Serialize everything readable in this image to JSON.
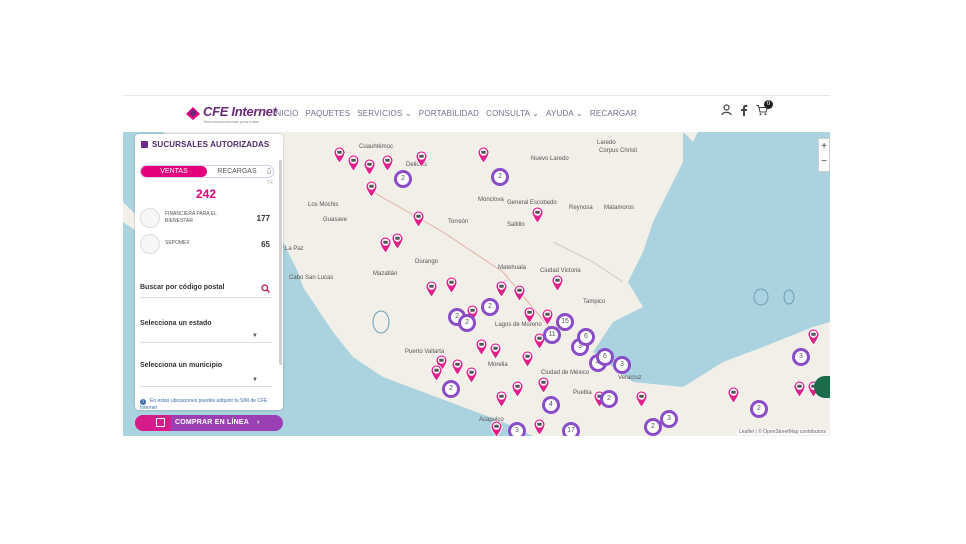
{
  "header": {
    "logo_text": "CFE Internet",
    "logo_tagline": "Telecomunicaciones para todos",
    "menu": [
      "INICIO",
      "PAQUETES",
      "SERVICIOS ⌄",
      "PORTABILIDAD",
      "CONSULTA ⌄",
      "AYUDA ⌄",
      "RECARGAR"
    ],
    "cart_count": "0",
    "icons": [
      "user-icon",
      "facebook-icon",
      "cart-icon"
    ]
  },
  "panel": {
    "title": "SUCURSALES AUTORIZADAS",
    "tab_active": "VENTAS",
    "tab_other": "RECARGAS",
    "total": "242",
    "tx_label": "TX",
    "providers": [
      {
        "name": "FINANCIERA PARA EL BIENESTAR",
        "count": "177"
      },
      {
        "name": "SEPOMEX",
        "count": "65"
      }
    ],
    "postal_label": "Buscar por código postal",
    "state_label": "Selecciona un estado",
    "municipality_label": "Selecciona un municipio",
    "note": "En estas ubicaciones puedes adquirir tu SIM de CFE Internet",
    "buy_button": "COMPRAR EN LÍNEA"
  },
  "map": {
    "labels": [
      {
        "text": "Cuauhtémoc"
      },
      {
        "text": "Delicias"
      },
      {
        "text": "Monclova"
      },
      {
        "text": "Nuevo Laredo"
      },
      {
        "text": "Laredo"
      },
      {
        "text": "Corpus Christi"
      },
      {
        "text": "General Escobedo"
      },
      {
        "text": "Reynosa"
      },
      {
        "text": "Matamoros"
      },
      {
        "text": "Los Mochis"
      },
      {
        "text": "Guasave"
      },
      {
        "text": "Torreón"
      },
      {
        "text": "Saltillo"
      },
      {
        "text": "Durango"
      },
      {
        "text": "Mazatlán"
      },
      {
        "text": "La Paz"
      },
      {
        "text": "Cabo San Lucas"
      },
      {
        "text": "Ciudad Victoria"
      },
      {
        "text": "Matehuala"
      },
      {
        "text": "Tampico"
      },
      {
        "text": "Puerto Vallarta"
      },
      {
        "text": "Morelia"
      },
      {
        "text": "Ciudad de México"
      },
      {
        "text": "Puebla"
      },
      {
        "text": "Veracruz"
      },
      {
        "text": "Acapulco"
      },
      {
        "text": "Lagos de Moreno"
      }
    ],
    "cluster_counts": [
      "2",
      "2",
      "2",
      "2",
      "2",
      "15",
      "11",
      "3",
      "6",
      "4",
      "3",
      "6",
      "2",
      "2",
      "2",
      "4",
      "3",
      "3",
      "17",
      "2",
      "3"
    ],
    "zoom_in": "+",
    "zoom_out": "−",
    "attribution": "Leaflet | © OpenStreetMap contributors",
    "colors": {
      "water": "#aad3df",
      "land": "#f2efe9",
      "pin": "#e0218a",
      "cluster": "#8a4cc8"
    }
  }
}
